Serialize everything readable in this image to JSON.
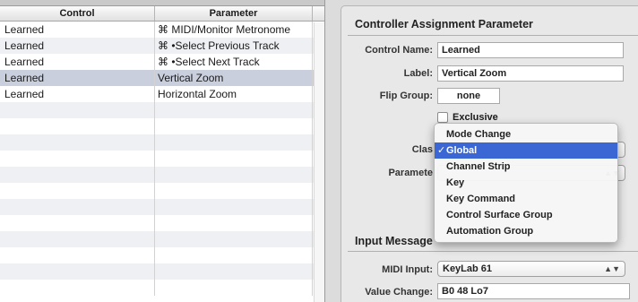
{
  "table": {
    "columns": [
      "Control",
      "Parameter"
    ],
    "rows": [
      {
        "control": "Learned",
        "parameter": "⌘ MIDI/Monitor Metronome"
      },
      {
        "control": "Learned",
        "parameter": "⌘ •Select Previous Track"
      },
      {
        "control": "Learned",
        "parameter": "⌘ •Select Next Track"
      },
      {
        "control": "Learned",
        "parameter": "Vertical Zoom"
      },
      {
        "control": "Learned",
        "parameter": "Horizontal Zoom"
      }
    ],
    "selected_row": 3
  },
  "inspector": {
    "assignment_title": "Controller Assignment Parameter",
    "control_name_label": "Control Name:",
    "control_name_value": "Learned",
    "label_label": "Label:",
    "label_value": "Vertical Zoom",
    "flip_group_label": "Flip Group:",
    "flip_group_value": "none",
    "exclusive_label": "Exclusive",
    "class_label": "Clas",
    "parameter_label": "Paramete",
    "input_message_title": "Input Message",
    "midi_input_label": "MIDI Input:",
    "midi_input_value": "KeyLab 61",
    "value_change_label": "Value Change:",
    "value_change_value": "B0 48 Lo7"
  },
  "menu": {
    "items": [
      {
        "label": "Mode Change",
        "checked": false
      },
      {
        "label": "Global",
        "checked": true
      },
      {
        "label": "Channel Strip",
        "checked": false
      },
      {
        "label": "Key",
        "checked": false
      },
      {
        "label": "Key Command",
        "checked": false
      },
      {
        "label": "Control Surface Group",
        "checked": false
      },
      {
        "label": "Automation Group",
        "checked": false
      }
    ],
    "check_glyph": "✓"
  },
  "colors": {
    "selection": "#c9cfdc",
    "menu_highlight": "#3a67d4"
  }
}
